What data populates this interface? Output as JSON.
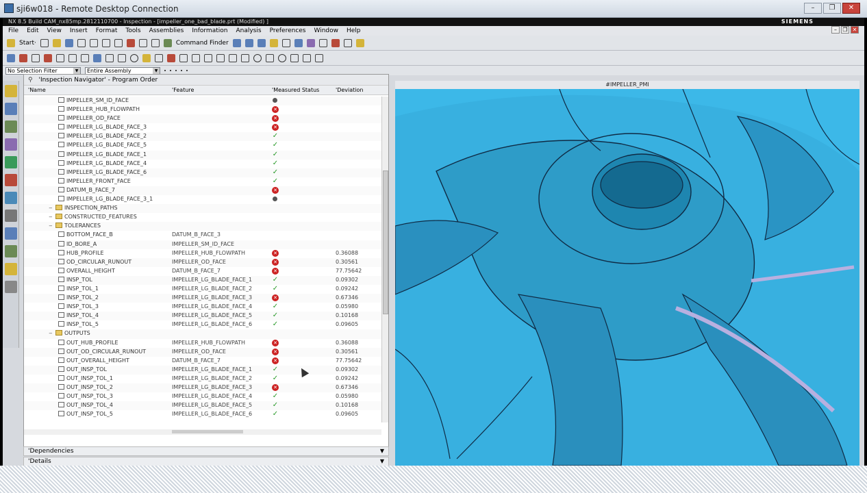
{
  "window": {
    "title": "sji6w018 - Remote Desktop Connection",
    "icon": "remote-desktop-icon"
  },
  "nx": {
    "title": "NX 8.5 Build CAM_nx85mp.2812110700 - Inspection - [impeller_one_bad_blade.prt (Modified) ]",
    "brand": "SIEMENS"
  },
  "menu": [
    "File",
    "Edit",
    "View",
    "Insert",
    "Format",
    "Tools",
    "Assemblies",
    "Information",
    "Analysis",
    "Preferences",
    "Window",
    "Help"
  ],
  "toolbar": {
    "start": "Start·",
    "command_finder": "Command Finder"
  },
  "selection": {
    "filter": "No Selection Filter",
    "scope": "Entire Assembly"
  },
  "navigator": {
    "title": "'Inspection Navigator' - Program Order",
    "columns": [
      "'Name",
      "'Feature",
      "'Measured Status",
      "'Deviation"
    ],
    "rows": [
      {
        "name": "IMPELLER_SM_ID_FACE",
        "feature": "",
        "status": "none",
        "deviation": "",
        "indent": 2
      },
      {
        "name": "IMPELLER_HUB_FLOWPATH",
        "feature": "",
        "status": "fail",
        "deviation": "",
        "indent": 2
      },
      {
        "name": "IMPELLER_OD_FACE",
        "feature": "",
        "status": "fail",
        "deviation": "",
        "indent": 2
      },
      {
        "name": "IMPELLER_LG_BLADE_FACE_3",
        "feature": "",
        "status": "fail",
        "deviation": "",
        "indent": 2
      },
      {
        "name": "IMPELLER_LG_BLADE_FACE_2",
        "feature": "",
        "status": "pass",
        "deviation": "",
        "indent": 2
      },
      {
        "name": "IMPELLER_LG_BLADE_FACE_5",
        "feature": "",
        "status": "pass",
        "deviation": "",
        "indent": 2
      },
      {
        "name": "IMPELLER_LG_BLADE_FACE_1",
        "feature": "",
        "status": "pass",
        "deviation": "",
        "indent": 2
      },
      {
        "name": "IMPELLER_LG_BLADE_FACE_4",
        "feature": "",
        "status": "pass",
        "deviation": "",
        "indent": 2
      },
      {
        "name": "IMPELLER_LG_BLADE_FACE_6",
        "feature": "",
        "status": "pass",
        "deviation": "",
        "indent": 2
      },
      {
        "name": "IMPELLER_FRONT_FACE",
        "feature": "",
        "status": "pass",
        "deviation": "",
        "indent": 2
      },
      {
        "name": "DATUM_B_FACE_7",
        "feature": "",
        "status": "fail",
        "deviation": "",
        "indent": 2
      },
      {
        "name": "IMPELLER_LG_BLADE_FACE_3_1",
        "feature": "",
        "status": "none",
        "deviation": "",
        "indent": 2
      },
      {
        "name": "INSPECTION_PATHS",
        "feature": "",
        "status": "",
        "deviation": "",
        "indent": 1,
        "folder": true
      },
      {
        "name": "CONSTRUCTED_FEATURES",
        "feature": "",
        "status": "",
        "deviation": "",
        "indent": 1,
        "folder": true
      },
      {
        "name": "TOLERANCES",
        "feature": "",
        "status": "",
        "deviation": "",
        "indent": 1,
        "folder": true
      },
      {
        "name": "BOTTOM_FACE_B",
        "feature": "DATUM_B_FACE_3",
        "status": "",
        "deviation": "",
        "indent": 2
      },
      {
        "name": "ID_BORE_A",
        "feature": "IMPELLER_SM_ID_FACE",
        "status": "",
        "deviation": "",
        "indent": 2
      },
      {
        "name": "HUB_PROFILE",
        "feature": "IMPELLER_HUB_FLOWPATH",
        "status": "fail",
        "deviation": "0.36088",
        "indent": 2
      },
      {
        "name": "OD_CIRCULAR_RUNOUT",
        "feature": "IMPELLER_OD_FACE",
        "status": "fail",
        "deviation": "0.30561",
        "indent": 2
      },
      {
        "name": "OVERALL_HEIGHT",
        "feature": "DATUM_B_FACE_7",
        "status": "fail",
        "deviation": "77.75642",
        "indent": 2
      },
      {
        "name": "INSP_TOL",
        "feature": "IMPELLER_LG_BLADE_FACE_1",
        "status": "pass",
        "deviation": "0.09302",
        "indent": 2
      },
      {
        "name": "INSP_TOL_1",
        "feature": "IMPELLER_LG_BLADE_FACE_2",
        "status": "pass",
        "deviation": "0.09242",
        "indent": 2
      },
      {
        "name": "INSP_TOL_2",
        "feature": "IMPELLER_LG_BLADE_FACE_3",
        "status": "fail",
        "deviation": "0.67346",
        "indent": 2
      },
      {
        "name": "INSP_TOL_3",
        "feature": "IMPELLER_LG_BLADE_FACE_4",
        "status": "pass",
        "deviation": "0.05980",
        "indent": 2
      },
      {
        "name": "INSP_TOL_4",
        "feature": "IMPELLER_LG_BLADE_FACE_5",
        "status": "pass",
        "deviation": "0.10168",
        "indent": 2
      },
      {
        "name": "INSP_TOL_5",
        "feature": "IMPELLER_LG_BLADE_FACE_6",
        "status": "pass",
        "deviation": "0.09605",
        "indent": 2
      },
      {
        "name": "OUTPUTS",
        "feature": "",
        "status": "",
        "deviation": "",
        "indent": 1,
        "folder": true
      },
      {
        "name": "OUT_HUB_PROFILE",
        "feature": "IMPELLER_HUB_FLOWPATH",
        "status": "fail",
        "deviation": "0.36088",
        "indent": 2
      },
      {
        "name": "OUT_OD_CIRCULAR_RUNOUT",
        "feature": "IMPELLER_OD_FACE",
        "status": "fail",
        "deviation": "0.30561",
        "indent": 2
      },
      {
        "name": "OUT_OVERALL_HEIGHT",
        "feature": "DATUM_B_FACE_7",
        "status": "fail",
        "deviation": "77.75642",
        "indent": 2
      },
      {
        "name": "OUT_INSP_TOL",
        "feature": "IMPELLER_LG_BLADE_FACE_1",
        "status": "pass",
        "deviation": "0.09302",
        "indent": 2
      },
      {
        "name": "OUT_INSP_TOL_1",
        "feature": "IMPELLER_LG_BLADE_FACE_2",
        "status": "pass",
        "deviation": "0.09242",
        "indent": 2
      },
      {
        "name": "OUT_INSP_TOL_2",
        "feature": "IMPELLER_LG_BLADE_FACE_3",
        "status": "fail",
        "deviation": "0.67346",
        "indent": 2
      },
      {
        "name": "OUT_INSP_TOL_3",
        "feature": "IMPELLER_LG_BLADE_FACE_4",
        "status": "pass",
        "deviation": "0.05980",
        "indent": 2
      },
      {
        "name": "OUT_INSP_TOL_4",
        "feature": "IMPELLER_LG_BLADE_FACE_5",
        "status": "pass",
        "deviation": "0.10168",
        "indent": 2
      },
      {
        "name": "OUT_INSP_TOL_5",
        "feature": "IMPELLER_LG_BLADE_FACE_6",
        "status": "pass",
        "deviation": "0.09605",
        "indent": 2
      }
    ]
  },
  "panels": {
    "dependencies": "'Dependencies",
    "details": "'Details"
  },
  "viewport": {
    "label": "#IMPELLER_PMI",
    "bg_color": "#3cb8e8"
  }
}
